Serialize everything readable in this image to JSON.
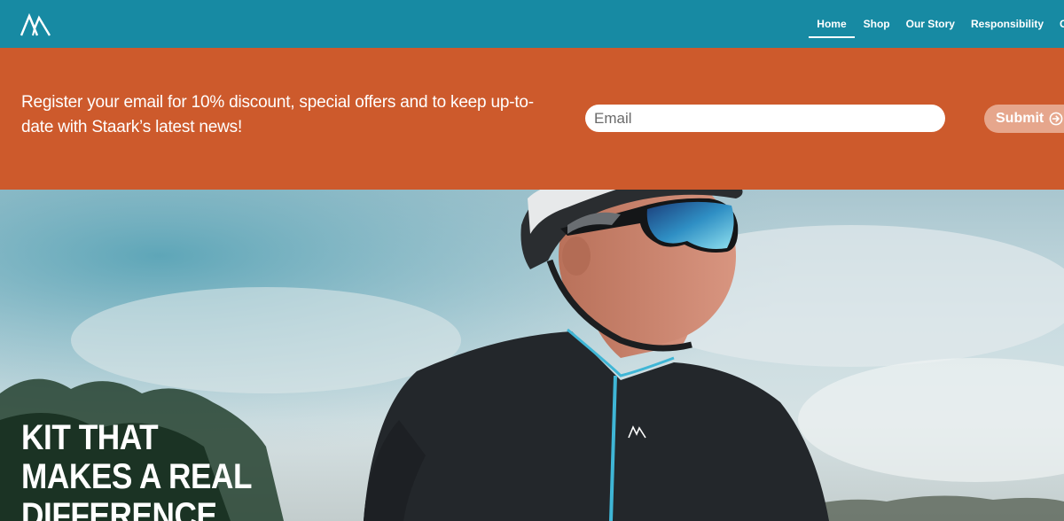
{
  "header": {
    "logo_icon": "mountain-peaks-logo-icon",
    "nav": [
      {
        "label": "Home",
        "active": true
      },
      {
        "label": "Shop",
        "active": false
      },
      {
        "label": "Our Story",
        "active": false
      },
      {
        "label": "Responsibility",
        "active": false
      },
      {
        "label": "C",
        "active": false
      }
    ]
  },
  "promo": {
    "text": "Register your email for 10% discount, special offers and to keep up-to-date with Staark’s latest news!",
    "email_placeholder": "Email",
    "submit_label": "Submit",
    "submit_icon": "arrow-circle-right-icon"
  },
  "hero": {
    "line1": "KIT THAT",
    "line2_bold": "MAKES",
    "line2_rest": " A REAL",
    "line3_bold": "DIFFERENCE"
  },
  "colors": {
    "header_bg": "#178aa3",
    "promo_bg": "#cd5a2c",
    "submit_bg": "#e6a68c",
    "jersey": "#23272b",
    "zip_accent": "#3fb6d6"
  }
}
